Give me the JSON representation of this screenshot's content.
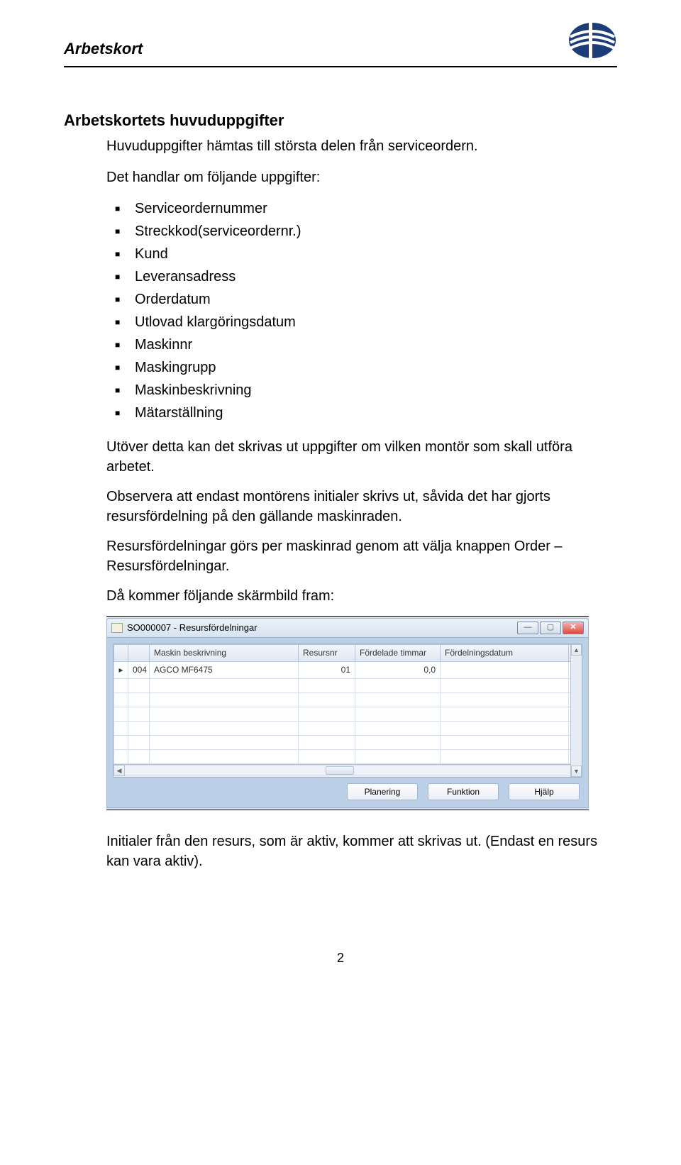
{
  "header": {
    "title": "Arbetskort"
  },
  "section": {
    "title": "Arbetskortets huvuduppgifter",
    "intro": "Huvuduppgifter hämtas till största delen från serviceordern.",
    "lead": "Det handlar om följande uppgifter:",
    "bullets": [
      "Serviceordernummer",
      "Streckkod(serviceordernr.)",
      "Kund",
      "Leveransadress",
      "Orderdatum",
      "Utlovad klargöringsdatum",
      "Maskinnr",
      "Maskingrupp",
      "Maskinbeskrivning",
      "Mätarställning"
    ],
    "para1": "Utöver detta kan det skrivas ut uppgifter om vilken montör som skall utföra arbetet.",
    "para2": "Observera att endast montörens initialer skrivs ut, såvida det har gjorts resursfördelning på den gällande maskinraden.",
    "para3": "Resursfördelningar görs per maskinrad genom att välja knappen Order – Resursfördelningar.",
    "para4": "Då kommer följande skärmbild fram:"
  },
  "window": {
    "title": "SO000007 - Resursfördelningar",
    "columns": [
      "",
      "Maskin beskrivning",
      "Resursnr",
      "Fördelade timmar",
      "Fördelningsdatum"
    ],
    "rows": [
      {
        "id": "004",
        "desc": "AGCO MF6475",
        "resurs": "01",
        "timmar": "0,0",
        "datum": ""
      }
    ],
    "buttons": {
      "planering": "Planering",
      "funktion": "Funktion",
      "hjalp": "Hjälp"
    }
  },
  "footer": {
    "para": "Initialer från den resurs, som är aktiv, kommer att skrivas ut. (Endast en resurs kan vara aktiv).",
    "page_number": "2"
  }
}
